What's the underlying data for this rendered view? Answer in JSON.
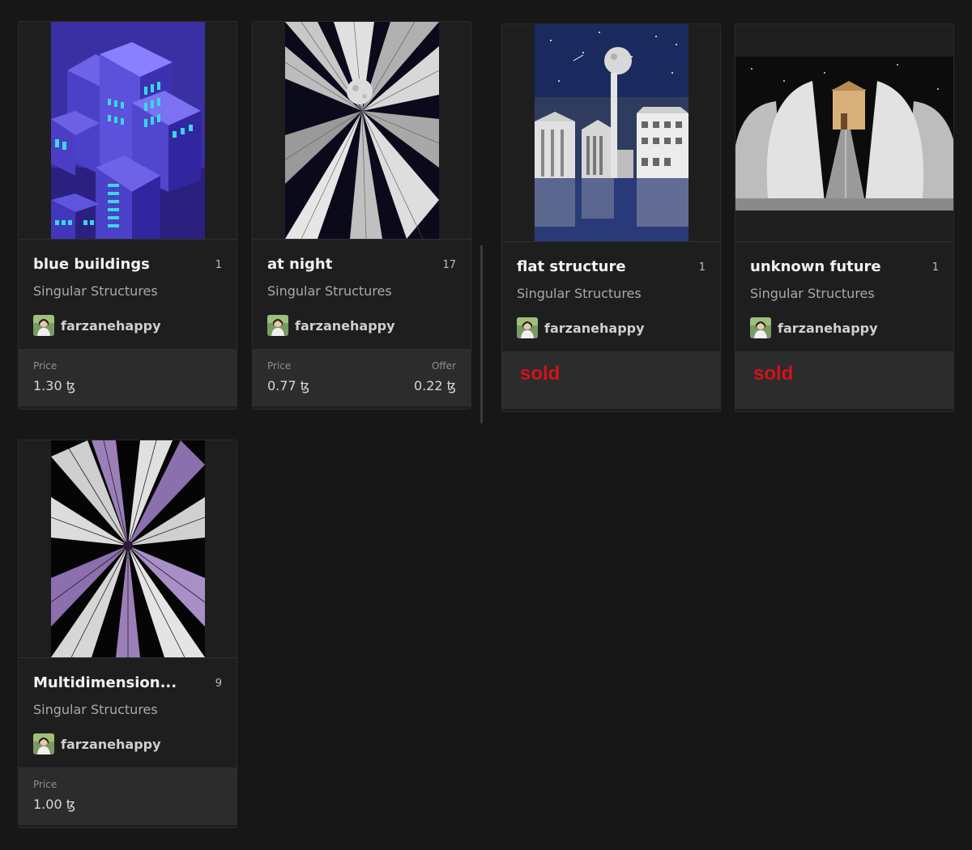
{
  "cards": [
    {
      "title": "blue buildings",
      "edition": "1",
      "collection": "Singular Structures",
      "creator": "farzanehappy",
      "price_label": "Price",
      "price": "1.30 ꜩ"
    },
    {
      "title": "at night",
      "edition": "17",
      "collection": "Singular Structures",
      "creator": "farzanehappy",
      "price_label": "Price",
      "price": "0.77 ꜩ",
      "offer_label": "Offer",
      "offer": "0.22 ꜩ"
    },
    {
      "title": "flat structure",
      "edition": "1",
      "collection": "Singular Structures",
      "creator": "farzanehappy",
      "status": "sold"
    },
    {
      "title": "unknown future",
      "edition": "1",
      "collection": "Singular Structures",
      "creator": "farzanehappy",
      "status": "sold"
    },
    {
      "title": "Multidimension...",
      "edition": "9",
      "collection": "Singular Structures",
      "creator": "farzanehappy",
      "price_label": "Price",
      "price": "1.00 ꜩ"
    }
  ],
  "colors": {
    "background": "#171717",
    "card": "#1e1e1e",
    "footer": "#2c2c2c",
    "sold": "#d3121a"
  }
}
